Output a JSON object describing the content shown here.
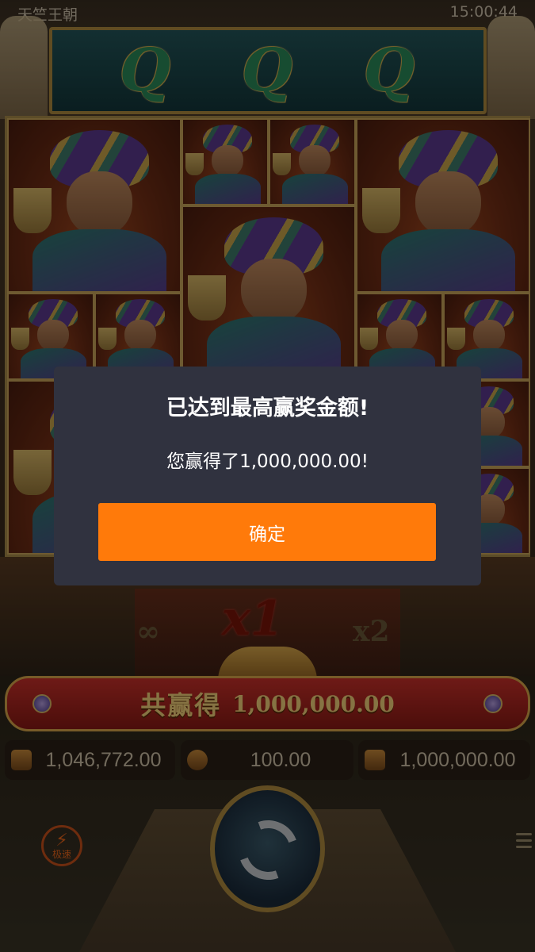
{
  "status_bar": {
    "game_title": "天竺王朝",
    "clock": "15:00:44"
  },
  "reels": {
    "top_row_symbols": [
      "Q",
      "Q",
      "Q"
    ],
    "grid_symbol": "prince-portrait"
  },
  "multipliers": {
    "current": "x1",
    "next": "x2",
    "infinite": "∞"
  },
  "total_win": {
    "label": "共赢得",
    "value": "1,000,000.00"
  },
  "stats": {
    "balance": {
      "icon": "wallet-icon",
      "value": "1,046,772.00"
    },
    "bet": {
      "icon": "coins-icon",
      "value": "100.00"
    },
    "win": {
      "icon": "win-icon",
      "value": "1,000,000.00"
    }
  },
  "controls": {
    "turbo_label": "极速",
    "spin_icon": "spin-icon"
  },
  "dialog": {
    "title": "已达到最高赢奖金额!",
    "message": "您赢得了1,000,000.00!",
    "confirm_label": "确定"
  },
  "colors": {
    "dialog_bg": "#30323f",
    "confirm_button": "#ff7a0a",
    "banner_red": "#c9302a",
    "gold": "#d9a74a"
  }
}
